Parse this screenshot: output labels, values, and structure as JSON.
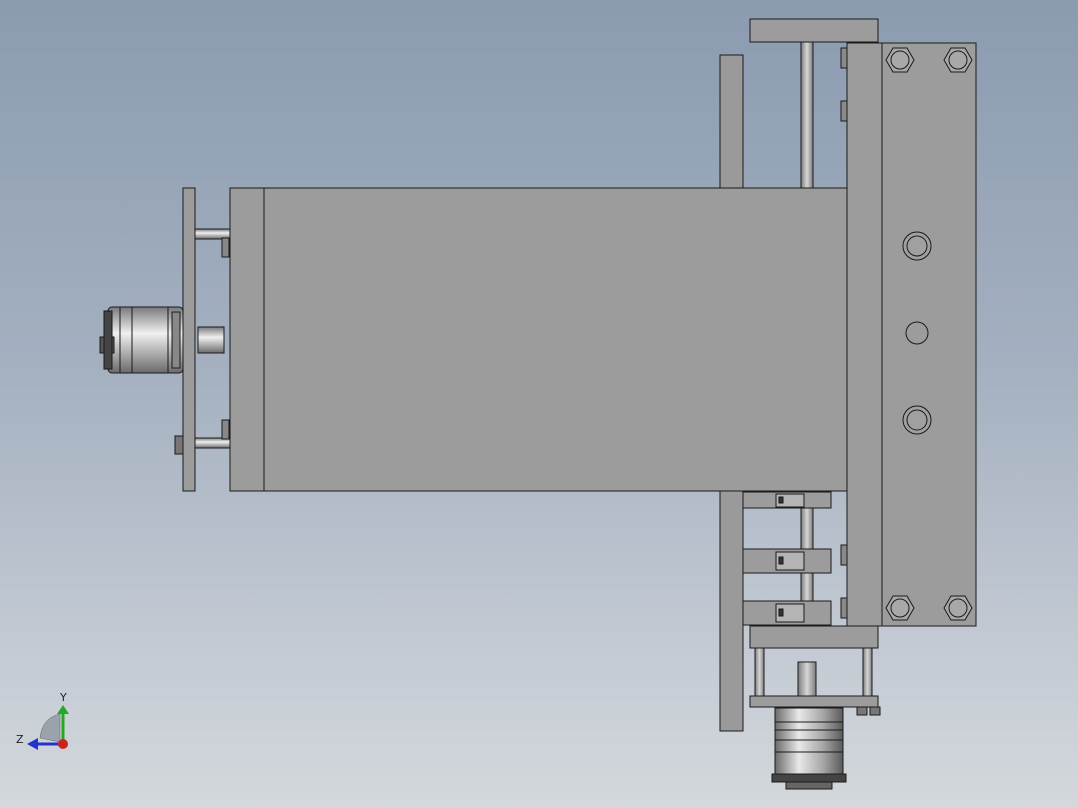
{
  "view": {
    "background_top": "#8b9bb0",
    "background_bottom": "#d4d8dc",
    "part_color": "#9c9c9c",
    "edge_color": "#1a1a1a"
  },
  "triad": {
    "y_label": "Y",
    "z_label": "Z",
    "y_color": "#22aa22",
    "z_color": "#2233cc",
    "x_color": "#cc2222"
  }
}
